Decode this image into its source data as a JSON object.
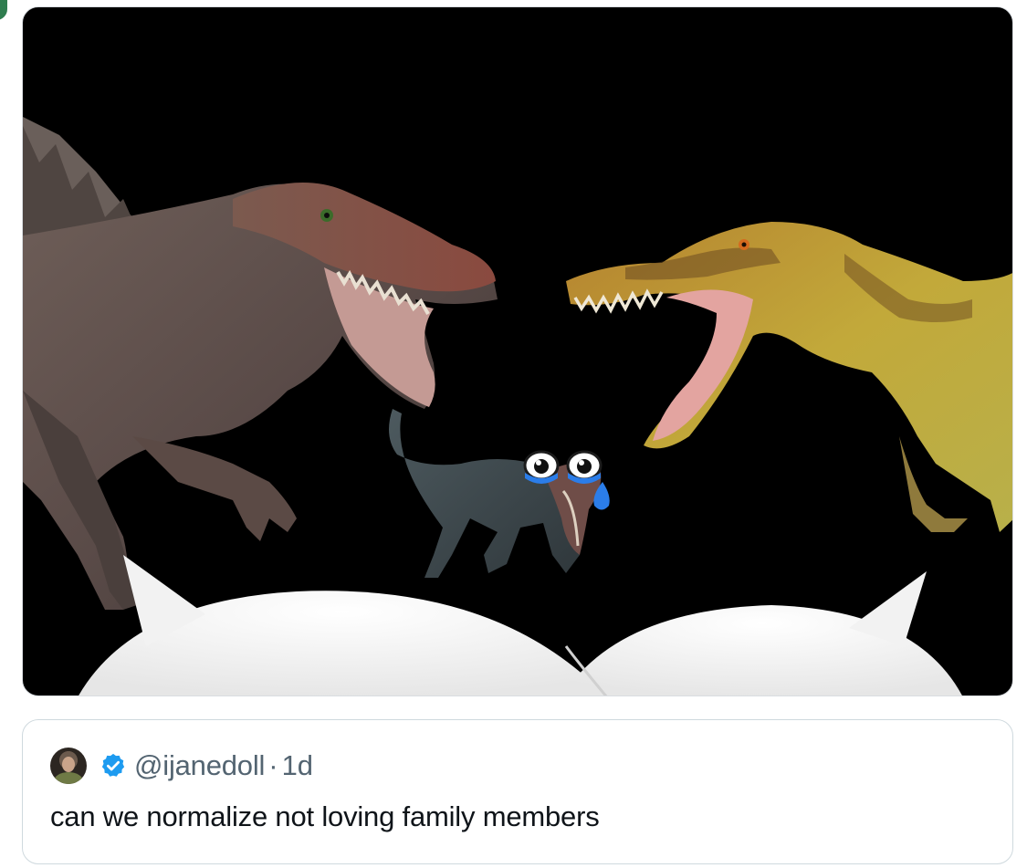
{
  "quoted_post": {
    "handle": "@ijanedoll",
    "separator": "·",
    "time": "1d",
    "text": "can we normalize not loving family members",
    "verified_color": "#1d9bf0"
  },
  "media": {
    "background": "#000000"
  },
  "icons": [
    "verified-badge-icon",
    "crying-emoji-icon"
  ]
}
